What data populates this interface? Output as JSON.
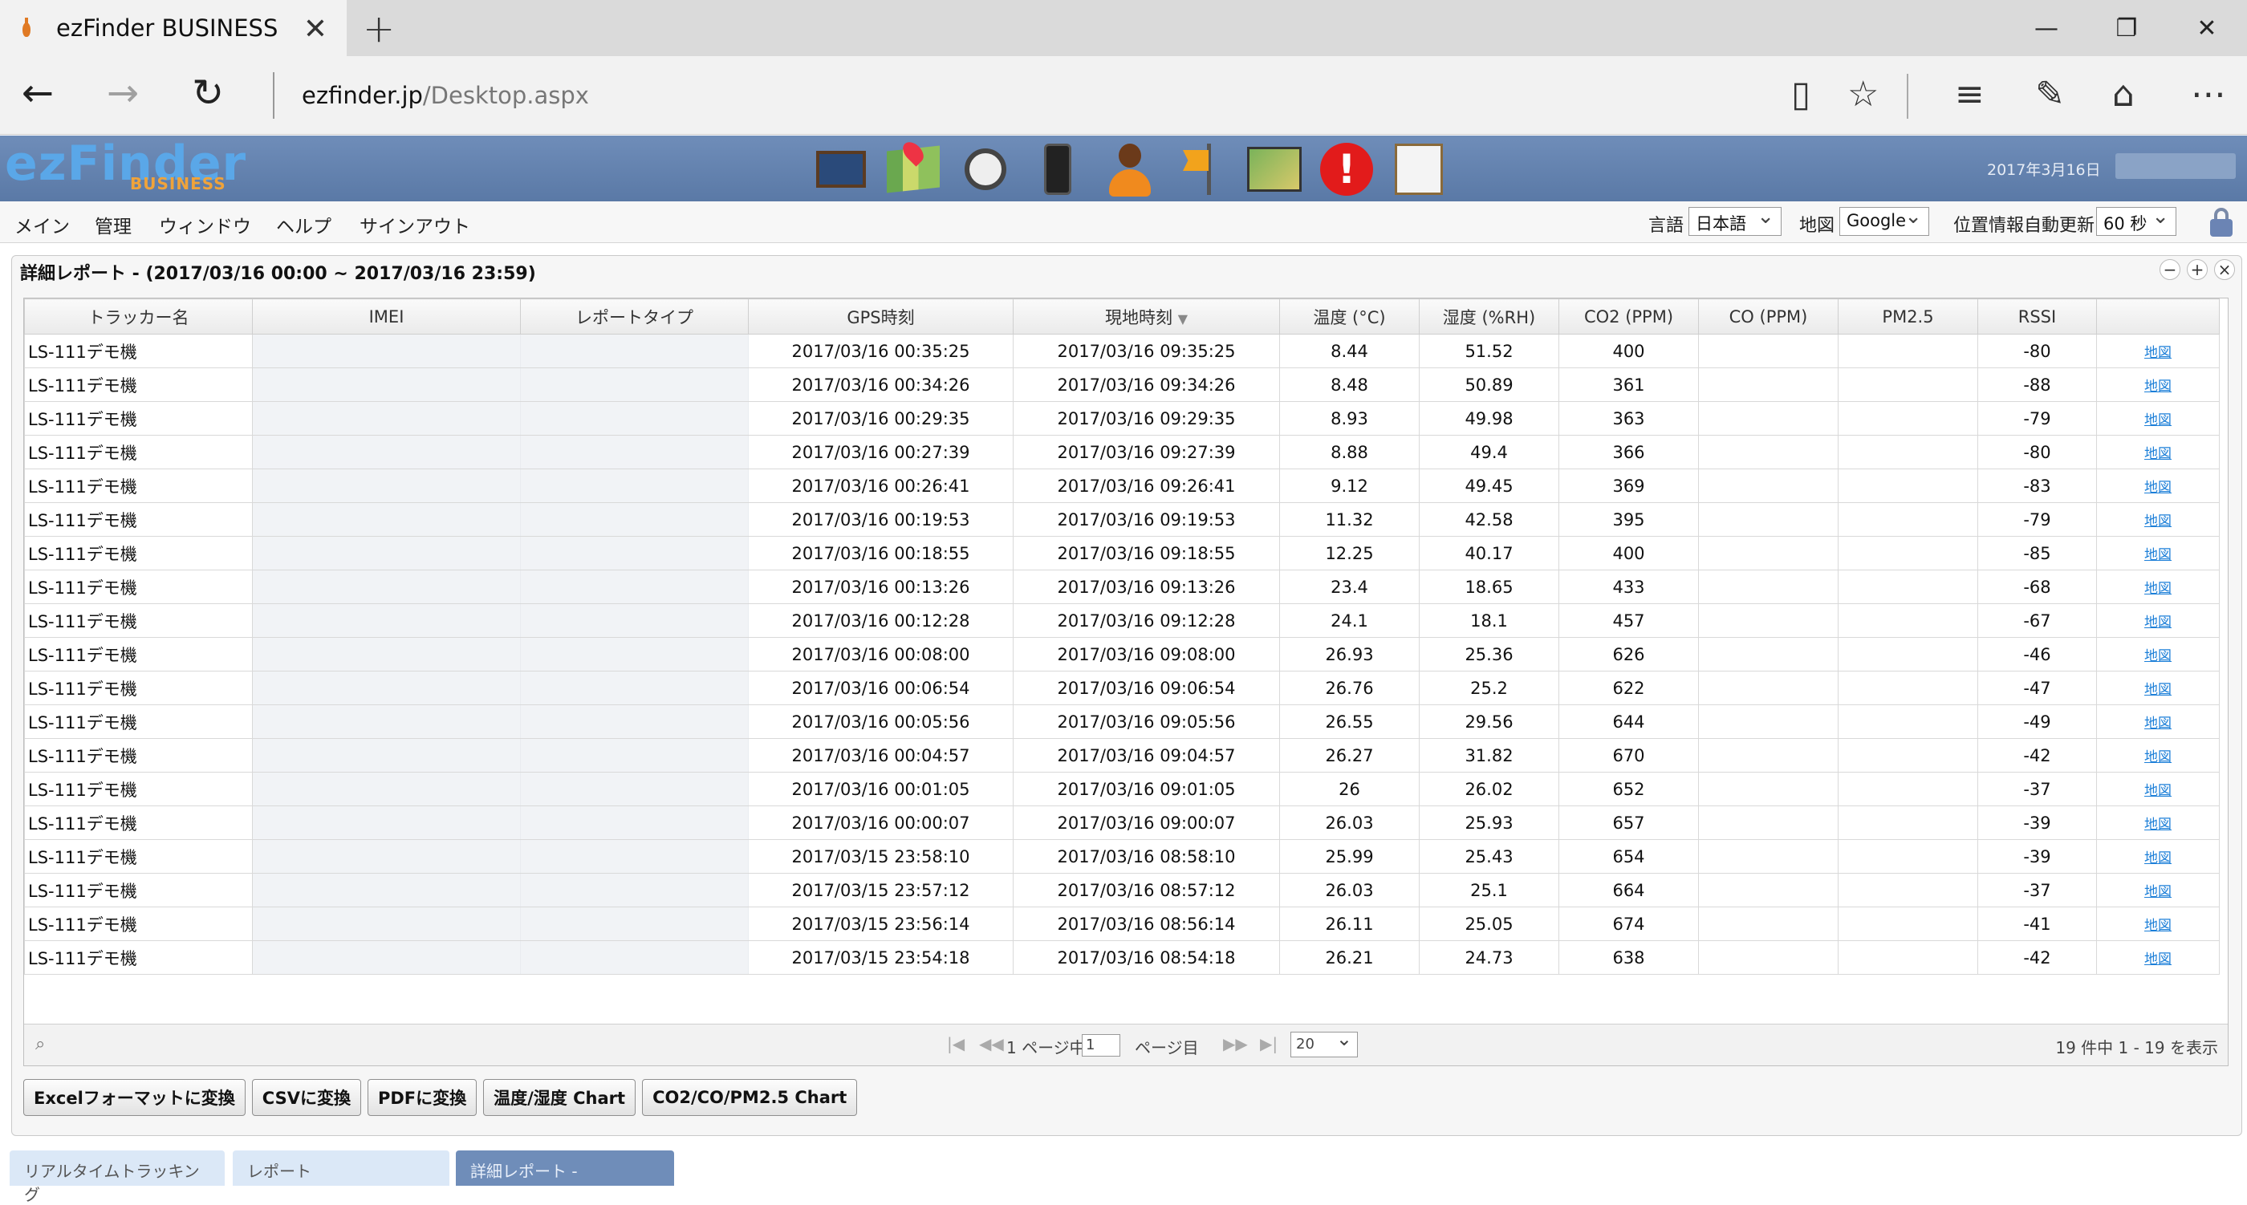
{
  "browser": {
    "tab_title": "ezFinder BUSINESS",
    "url_host": "ezfinder.jp",
    "url_path": "/Desktop.aspx"
  },
  "app": {
    "logo_main": "ezFinder",
    "logo_sub": "BUSINESS",
    "date": "2017年3月16日",
    "header_icons": [
      "monitor-icon",
      "map-pin-icon",
      "watch-icon",
      "phone-icon",
      "person-icon",
      "flag-icon",
      "route-map-icon",
      "alert-icon",
      "chart-icon"
    ]
  },
  "menu": {
    "items": [
      "メイン",
      "管理",
      "ウィンドウ",
      "ヘルプ",
      "サインアウト"
    ],
    "language_label": "言語",
    "language_value": "日本語",
    "map_label": "地図",
    "map_value": "Google",
    "refresh_label": "位置情報自動更新",
    "refresh_value": "60 秒"
  },
  "report": {
    "title": "詳細レポート - (2017/03/16 00:00 ~ 2017/03/16 23:59)",
    "columns": [
      "トラッカー名",
      "IMEI",
      "レポートタイプ",
      "GPS時刻",
      "現地時刻",
      "温度 (°C)",
      "湿度 (%RH)",
      "CO2 (PPM)",
      "CO (PPM)",
      "PM2.5",
      "RSSI",
      ""
    ],
    "rows": [
      {
        "tracker": "LS-111デモ機",
        "imei": "",
        "type": "",
        "gps": "2017/03/16 00:35:25",
        "local": "2017/03/16 09:35:25",
        "temp": "8.44",
        "hum": "51.52",
        "co2": "400",
        "co": "",
        "pm25": "",
        "rssi": "-80",
        "link": "地図"
      },
      {
        "tracker": "LS-111デモ機",
        "imei": "",
        "type": "",
        "gps": "2017/03/16 00:34:26",
        "local": "2017/03/16 09:34:26",
        "temp": "8.48",
        "hum": "50.89",
        "co2": "361",
        "co": "",
        "pm25": "",
        "rssi": "-88",
        "link": "地図"
      },
      {
        "tracker": "LS-111デモ機",
        "imei": "",
        "type": "",
        "gps": "2017/03/16 00:29:35",
        "local": "2017/03/16 09:29:35",
        "temp": "8.93",
        "hum": "49.98",
        "co2": "363",
        "co": "",
        "pm25": "",
        "rssi": "-79",
        "link": "地図"
      },
      {
        "tracker": "LS-111デモ機",
        "imei": "",
        "type": "",
        "gps": "2017/03/16 00:27:39",
        "local": "2017/03/16 09:27:39",
        "temp": "8.88",
        "hum": "49.4",
        "co2": "366",
        "co": "",
        "pm25": "",
        "rssi": "-80",
        "link": "地図"
      },
      {
        "tracker": "LS-111デモ機",
        "imei": "",
        "type": "",
        "gps": "2017/03/16 00:26:41",
        "local": "2017/03/16 09:26:41",
        "temp": "9.12",
        "hum": "49.45",
        "co2": "369",
        "co": "",
        "pm25": "",
        "rssi": "-83",
        "link": "地図"
      },
      {
        "tracker": "LS-111デモ機",
        "imei": "",
        "type": "",
        "gps": "2017/03/16 00:19:53",
        "local": "2017/03/16 09:19:53",
        "temp": "11.32",
        "hum": "42.58",
        "co2": "395",
        "co": "",
        "pm25": "",
        "rssi": "-79",
        "link": "地図"
      },
      {
        "tracker": "LS-111デモ機",
        "imei": "",
        "type": "",
        "gps": "2017/03/16 00:18:55",
        "local": "2017/03/16 09:18:55",
        "temp": "12.25",
        "hum": "40.17",
        "co2": "400",
        "co": "",
        "pm25": "",
        "rssi": "-85",
        "link": "地図"
      },
      {
        "tracker": "LS-111デモ機",
        "imei": "",
        "type": "",
        "gps": "2017/03/16 00:13:26",
        "local": "2017/03/16 09:13:26",
        "temp": "23.4",
        "hum": "18.65",
        "co2": "433",
        "co": "",
        "pm25": "",
        "rssi": "-68",
        "link": "地図"
      },
      {
        "tracker": "LS-111デモ機",
        "imei": "",
        "type": "",
        "gps": "2017/03/16 00:12:28",
        "local": "2017/03/16 09:12:28",
        "temp": "24.1",
        "hum": "18.1",
        "co2": "457",
        "co": "",
        "pm25": "",
        "rssi": "-67",
        "link": "地図"
      },
      {
        "tracker": "LS-111デモ機",
        "imei": "",
        "type": "",
        "gps": "2017/03/16 00:08:00",
        "local": "2017/03/16 09:08:00",
        "temp": "26.93",
        "hum": "25.36",
        "co2": "626",
        "co": "",
        "pm25": "",
        "rssi": "-46",
        "link": "地図"
      },
      {
        "tracker": "LS-111デモ機",
        "imei": "",
        "type": "",
        "gps": "2017/03/16 00:06:54",
        "local": "2017/03/16 09:06:54",
        "temp": "26.76",
        "hum": "25.2",
        "co2": "622",
        "co": "",
        "pm25": "",
        "rssi": "-47",
        "link": "地図"
      },
      {
        "tracker": "LS-111デモ機",
        "imei": "",
        "type": "",
        "gps": "2017/03/16 00:05:56",
        "local": "2017/03/16 09:05:56",
        "temp": "26.55",
        "hum": "29.56",
        "co2": "644",
        "co": "",
        "pm25": "",
        "rssi": "-49",
        "link": "地図"
      },
      {
        "tracker": "LS-111デモ機",
        "imei": "",
        "type": "",
        "gps": "2017/03/16 00:04:57",
        "local": "2017/03/16 09:04:57",
        "temp": "26.27",
        "hum": "31.82",
        "co2": "670",
        "co": "",
        "pm25": "",
        "rssi": "-42",
        "link": "地図"
      },
      {
        "tracker": "LS-111デモ機",
        "imei": "",
        "type": "",
        "gps": "2017/03/16 00:01:05",
        "local": "2017/03/16 09:01:05",
        "temp": "26",
        "hum": "26.02",
        "co2": "652",
        "co": "",
        "pm25": "",
        "rssi": "-37",
        "link": "地図"
      },
      {
        "tracker": "LS-111デモ機",
        "imei": "",
        "type": "",
        "gps": "2017/03/16 00:00:07",
        "local": "2017/03/16 09:00:07",
        "temp": "26.03",
        "hum": "25.93",
        "co2": "657",
        "co": "",
        "pm25": "",
        "rssi": "-39",
        "link": "地図"
      },
      {
        "tracker": "LS-111デモ機",
        "imei": "",
        "type": "",
        "gps": "2017/03/15 23:58:10",
        "local": "2017/03/16 08:58:10",
        "temp": "25.99",
        "hum": "25.43",
        "co2": "654",
        "co": "",
        "pm25": "",
        "rssi": "-39",
        "link": "地図"
      },
      {
        "tracker": "LS-111デモ機",
        "imei": "",
        "type": "",
        "gps": "2017/03/15 23:57:12",
        "local": "2017/03/16 08:57:12",
        "temp": "26.03",
        "hum": "25.1",
        "co2": "664",
        "co": "",
        "pm25": "",
        "rssi": "-37",
        "link": "地図"
      },
      {
        "tracker": "LS-111デモ機",
        "imei": "",
        "type": "",
        "gps": "2017/03/15 23:56:14",
        "local": "2017/03/16 08:56:14",
        "temp": "26.11",
        "hum": "25.05",
        "co2": "674",
        "co": "",
        "pm25": "",
        "rssi": "-41",
        "link": "地図"
      },
      {
        "tracker": "LS-111デモ機",
        "imei": "",
        "type": "",
        "gps": "2017/03/15 23:54:18",
        "local": "2017/03/16 08:54:18",
        "temp": "26.21",
        "hum": "24.73",
        "co2": "638",
        "co": "",
        "pm25": "",
        "rssi": "-42",
        "link": "地図"
      }
    ],
    "pager": {
      "page_prefix": "1 ページ中",
      "page_value": "1",
      "page_suffix": "ページ目",
      "page_size": "20",
      "summary": "19 件中 1 - 19 を表示"
    },
    "buttons": [
      "Excelフォーマットに変換",
      "CSVに変換",
      "PDFに変換",
      "温度/湿度 Chart",
      "CO2/CO/PM2.5 Chart"
    ]
  },
  "taskbar": [
    "リアルタイムトラッキング",
    "レポート",
    "詳細レポート -"
  ]
}
